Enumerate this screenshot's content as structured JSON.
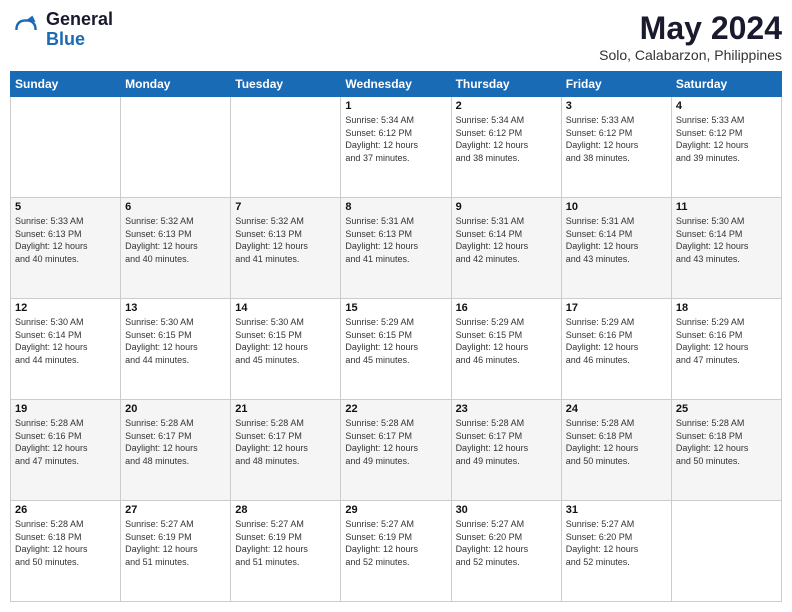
{
  "logo": {
    "line1": "General",
    "line2": "Blue"
  },
  "title": "May 2024",
  "subtitle": "Solo, Calabarzon, Philippines",
  "days_of_week": [
    "Sunday",
    "Monday",
    "Tuesday",
    "Wednesday",
    "Thursday",
    "Friday",
    "Saturday"
  ],
  "weeks": [
    [
      {
        "day": "",
        "info": ""
      },
      {
        "day": "",
        "info": ""
      },
      {
        "day": "",
        "info": ""
      },
      {
        "day": "1",
        "info": "Sunrise: 5:34 AM\nSunset: 6:12 PM\nDaylight: 12 hours\nand 37 minutes."
      },
      {
        "day": "2",
        "info": "Sunrise: 5:34 AM\nSunset: 6:12 PM\nDaylight: 12 hours\nand 38 minutes."
      },
      {
        "day": "3",
        "info": "Sunrise: 5:33 AM\nSunset: 6:12 PM\nDaylight: 12 hours\nand 38 minutes."
      },
      {
        "day": "4",
        "info": "Sunrise: 5:33 AM\nSunset: 6:12 PM\nDaylight: 12 hours\nand 39 minutes."
      }
    ],
    [
      {
        "day": "5",
        "info": "Sunrise: 5:33 AM\nSunset: 6:13 PM\nDaylight: 12 hours\nand 40 minutes."
      },
      {
        "day": "6",
        "info": "Sunrise: 5:32 AM\nSunset: 6:13 PM\nDaylight: 12 hours\nand 40 minutes."
      },
      {
        "day": "7",
        "info": "Sunrise: 5:32 AM\nSunset: 6:13 PM\nDaylight: 12 hours\nand 41 minutes."
      },
      {
        "day": "8",
        "info": "Sunrise: 5:31 AM\nSunset: 6:13 PM\nDaylight: 12 hours\nand 41 minutes."
      },
      {
        "day": "9",
        "info": "Sunrise: 5:31 AM\nSunset: 6:14 PM\nDaylight: 12 hours\nand 42 minutes."
      },
      {
        "day": "10",
        "info": "Sunrise: 5:31 AM\nSunset: 6:14 PM\nDaylight: 12 hours\nand 43 minutes."
      },
      {
        "day": "11",
        "info": "Sunrise: 5:30 AM\nSunset: 6:14 PM\nDaylight: 12 hours\nand 43 minutes."
      }
    ],
    [
      {
        "day": "12",
        "info": "Sunrise: 5:30 AM\nSunset: 6:14 PM\nDaylight: 12 hours\nand 44 minutes."
      },
      {
        "day": "13",
        "info": "Sunrise: 5:30 AM\nSunset: 6:15 PM\nDaylight: 12 hours\nand 44 minutes."
      },
      {
        "day": "14",
        "info": "Sunrise: 5:30 AM\nSunset: 6:15 PM\nDaylight: 12 hours\nand 45 minutes."
      },
      {
        "day": "15",
        "info": "Sunrise: 5:29 AM\nSunset: 6:15 PM\nDaylight: 12 hours\nand 45 minutes."
      },
      {
        "day": "16",
        "info": "Sunrise: 5:29 AM\nSunset: 6:15 PM\nDaylight: 12 hours\nand 46 minutes."
      },
      {
        "day": "17",
        "info": "Sunrise: 5:29 AM\nSunset: 6:16 PM\nDaylight: 12 hours\nand 46 minutes."
      },
      {
        "day": "18",
        "info": "Sunrise: 5:29 AM\nSunset: 6:16 PM\nDaylight: 12 hours\nand 47 minutes."
      }
    ],
    [
      {
        "day": "19",
        "info": "Sunrise: 5:28 AM\nSunset: 6:16 PM\nDaylight: 12 hours\nand 47 minutes."
      },
      {
        "day": "20",
        "info": "Sunrise: 5:28 AM\nSunset: 6:17 PM\nDaylight: 12 hours\nand 48 minutes."
      },
      {
        "day": "21",
        "info": "Sunrise: 5:28 AM\nSunset: 6:17 PM\nDaylight: 12 hours\nand 48 minutes."
      },
      {
        "day": "22",
        "info": "Sunrise: 5:28 AM\nSunset: 6:17 PM\nDaylight: 12 hours\nand 49 minutes."
      },
      {
        "day": "23",
        "info": "Sunrise: 5:28 AM\nSunset: 6:17 PM\nDaylight: 12 hours\nand 49 minutes."
      },
      {
        "day": "24",
        "info": "Sunrise: 5:28 AM\nSunset: 6:18 PM\nDaylight: 12 hours\nand 50 minutes."
      },
      {
        "day": "25",
        "info": "Sunrise: 5:28 AM\nSunset: 6:18 PM\nDaylight: 12 hours\nand 50 minutes."
      }
    ],
    [
      {
        "day": "26",
        "info": "Sunrise: 5:28 AM\nSunset: 6:18 PM\nDaylight: 12 hours\nand 50 minutes."
      },
      {
        "day": "27",
        "info": "Sunrise: 5:27 AM\nSunset: 6:19 PM\nDaylight: 12 hours\nand 51 minutes."
      },
      {
        "day": "28",
        "info": "Sunrise: 5:27 AM\nSunset: 6:19 PM\nDaylight: 12 hours\nand 51 minutes."
      },
      {
        "day": "29",
        "info": "Sunrise: 5:27 AM\nSunset: 6:19 PM\nDaylight: 12 hours\nand 52 minutes."
      },
      {
        "day": "30",
        "info": "Sunrise: 5:27 AM\nSunset: 6:20 PM\nDaylight: 12 hours\nand 52 minutes."
      },
      {
        "day": "31",
        "info": "Sunrise: 5:27 AM\nSunset: 6:20 PM\nDaylight: 12 hours\nand 52 minutes."
      },
      {
        "day": "",
        "info": ""
      }
    ]
  ]
}
